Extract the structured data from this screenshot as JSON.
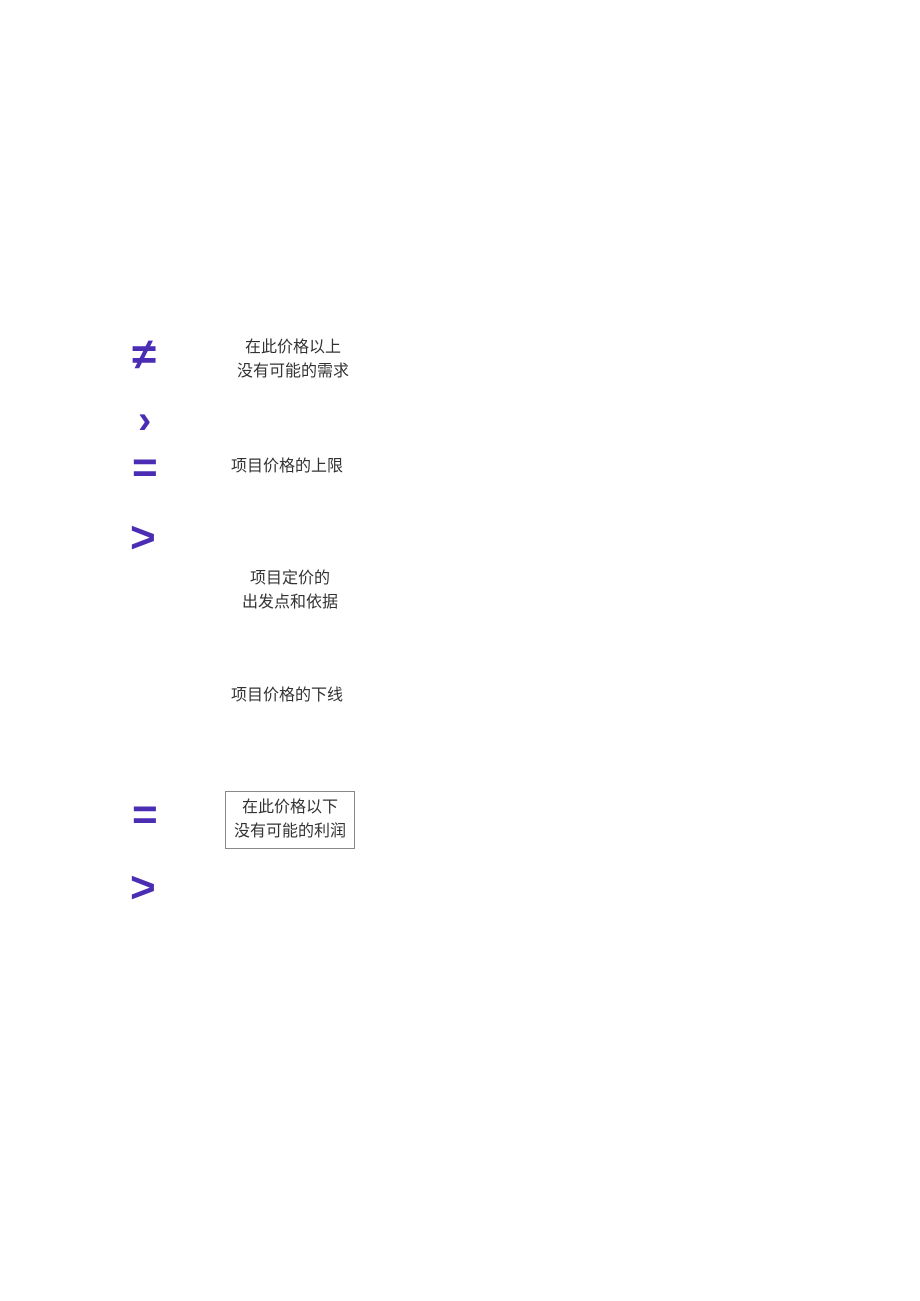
{
  "symbols": {
    "ne": "≠",
    "angle": "›",
    "eq1": "=",
    "gt1": ">",
    "eq2": "=",
    "gt2": ">"
  },
  "labels": {
    "upper_no_demand": "在此价格以上\n没有可能的需求",
    "price_upper_limit": "项目价格的上限",
    "pricing_basis": "项目定价的\n出发点和依据",
    "price_lower_limit": "项目价格的下线",
    "lower_no_profit": "在此价格以下\n没有可能的利润"
  },
  "colors": {
    "symbol": "#4a2db3",
    "text": "#333333",
    "border": "#888888"
  }
}
